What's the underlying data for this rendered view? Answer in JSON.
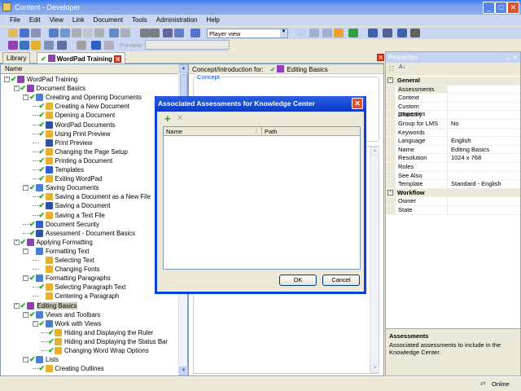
{
  "window": {
    "title": "Content - Developer"
  },
  "menu": [
    "File",
    "Edit",
    "View",
    "Link",
    "Document",
    "Tools",
    "Administration",
    "Help"
  ],
  "toolbar": {
    "view_select": "Player view",
    "preview_label": "Preview:"
  },
  "tabs": {
    "library": "Library",
    "active": "WordPad Training"
  },
  "tree": {
    "header": "Name",
    "items": [
      {
        "label": "WordPad Training",
        "level": 0,
        "check": true,
        "icon": "book",
        "exp": true
      },
      {
        "label": "Document Basics",
        "level": 1,
        "check": true,
        "icon": "book",
        "exp": true
      },
      {
        "label": "Creating and Opening Documents",
        "level": 2,
        "check": true,
        "icon": "section",
        "exp": true
      },
      {
        "label": "Creating a New Document",
        "level": 3,
        "check": true,
        "icon": "topic"
      },
      {
        "label": "Opening a Document",
        "level": 3,
        "check": true,
        "icon": "topic"
      },
      {
        "label": "WordPad Documents",
        "level": 3,
        "check": true,
        "icon": "question"
      },
      {
        "label": "Using Print Preview",
        "level": 3,
        "check": true,
        "icon": "topic"
      },
      {
        "label": "Print Preview",
        "level": 3,
        "check": false,
        "icon": "question"
      },
      {
        "label": "Changing the Page Setup",
        "level": 3,
        "check": true,
        "icon": "topic"
      },
      {
        "label": "Printing a Document",
        "level": 3,
        "check": true,
        "icon": "topic"
      },
      {
        "label": "Templates",
        "level": 3,
        "check": true,
        "icon": "document"
      },
      {
        "label": "Exiting WordPad",
        "level": 3,
        "check": true,
        "icon": "topic"
      },
      {
        "label": "Saving Documents",
        "level": 2,
        "check": true,
        "icon": "section",
        "exp": true
      },
      {
        "label": "Saving a Document as a New File",
        "level": 3,
        "check": true,
        "icon": "topic"
      },
      {
        "label": "Saving a Document",
        "level": 3,
        "check": true,
        "icon": "question"
      },
      {
        "label": "Saving a Text File",
        "level": 3,
        "check": true,
        "icon": "topic"
      },
      {
        "label": "Document Security",
        "level": 2,
        "check": true,
        "icon": "document"
      },
      {
        "label": "Assessment - Document Basics",
        "level": 2,
        "check": true,
        "icon": "question"
      },
      {
        "label": "Applying Formatting",
        "level": 1,
        "check": true,
        "icon": "book",
        "exp": true
      },
      {
        "label": "Formatting Text",
        "level": 2,
        "check": false,
        "icon": "section",
        "exp": true
      },
      {
        "label": "Selecting Text",
        "level": 3,
        "check": false,
        "icon": "topic"
      },
      {
        "label": "Changing Fonts",
        "level": 3,
        "check": false,
        "icon": "topic"
      },
      {
        "label": "Formatting Paragraphs",
        "level": 2,
        "check": true,
        "icon": "section",
        "exp": true
      },
      {
        "label": "Selecting Paragraph Text",
        "level": 3,
        "check": true,
        "icon": "topic"
      },
      {
        "label": "Centering a Paragraph",
        "level": 3,
        "check": false,
        "icon": "topic"
      },
      {
        "label": "Editing Basics",
        "level": 1,
        "check": true,
        "icon": "book",
        "exp": true,
        "selected": true
      },
      {
        "label": "Views and Toolbars",
        "level": 2,
        "check": true,
        "icon": "section",
        "exp": true
      },
      {
        "label": "Work with Views",
        "level": 3,
        "check": true,
        "icon": "section",
        "exp": true
      },
      {
        "label": "Hiding and Displaying the Ruler",
        "level": 4,
        "check": true,
        "icon": "topic"
      },
      {
        "label": "Hiding and Displaying the Status Bar",
        "level": 4,
        "check": true,
        "icon": "topic"
      },
      {
        "label": "Changing Word Wrap Options",
        "level": 4,
        "check": true,
        "icon": "topic"
      },
      {
        "label": "Lists",
        "level": 2,
        "check": true,
        "icon": "section",
        "exp": true
      },
      {
        "label": "Creating Outlines",
        "level": 3,
        "check": true,
        "icon": "topic"
      }
    ]
  },
  "middle": {
    "header_label": "Concept/Introduction for:",
    "header_value": "Editing Basics",
    "concept_label": "Concept"
  },
  "properties": {
    "title": "Properties",
    "rows": [
      {
        "cat": "General"
      },
      {
        "k": "Assessments",
        "v": ""
      },
      {
        "k": "Context",
        "v": ""
      },
      {
        "k": "Custom properties",
        "v": ""
      },
      {
        "k": "Glossary",
        "v": ""
      },
      {
        "k": "Group for LMS",
        "v": "No"
      },
      {
        "k": "Keywords",
        "v": ""
      },
      {
        "k": "Language",
        "v": "English"
      },
      {
        "k": "Name",
        "v": "Editing Basics"
      },
      {
        "k": "Resolution",
        "v": "1024 x 768"
      },
      {
        "k": "Roles",
        "v": ""
      },
      {
        "k": "See Also",
        "v": ""
      },
      {
        "k": "Template",
        "v": "Standard - English"
      },
      {
        "cat": "Workflow"
      },
      {
        "k": "Owner",
        "v": ""
      },
      {
        "k": "State",
        "v": ""
      }
    ],
    "desc_title": "Assessments",
    "desc_text": "Associated assessments to include in the Knowledge Center."
  },
  "dialog": {
    "title": "Associated Assessments for Knowledge Center",
    "col_name": "Name",
    "col_path": "Path",
    "ok": "OK",
    "cancel": "Cancel"
  },
  "status": {
    "online": "Online"
  },
  "colors": {
    "title": "#0a3bc8",
    "check": "#18b018"
  }
}
